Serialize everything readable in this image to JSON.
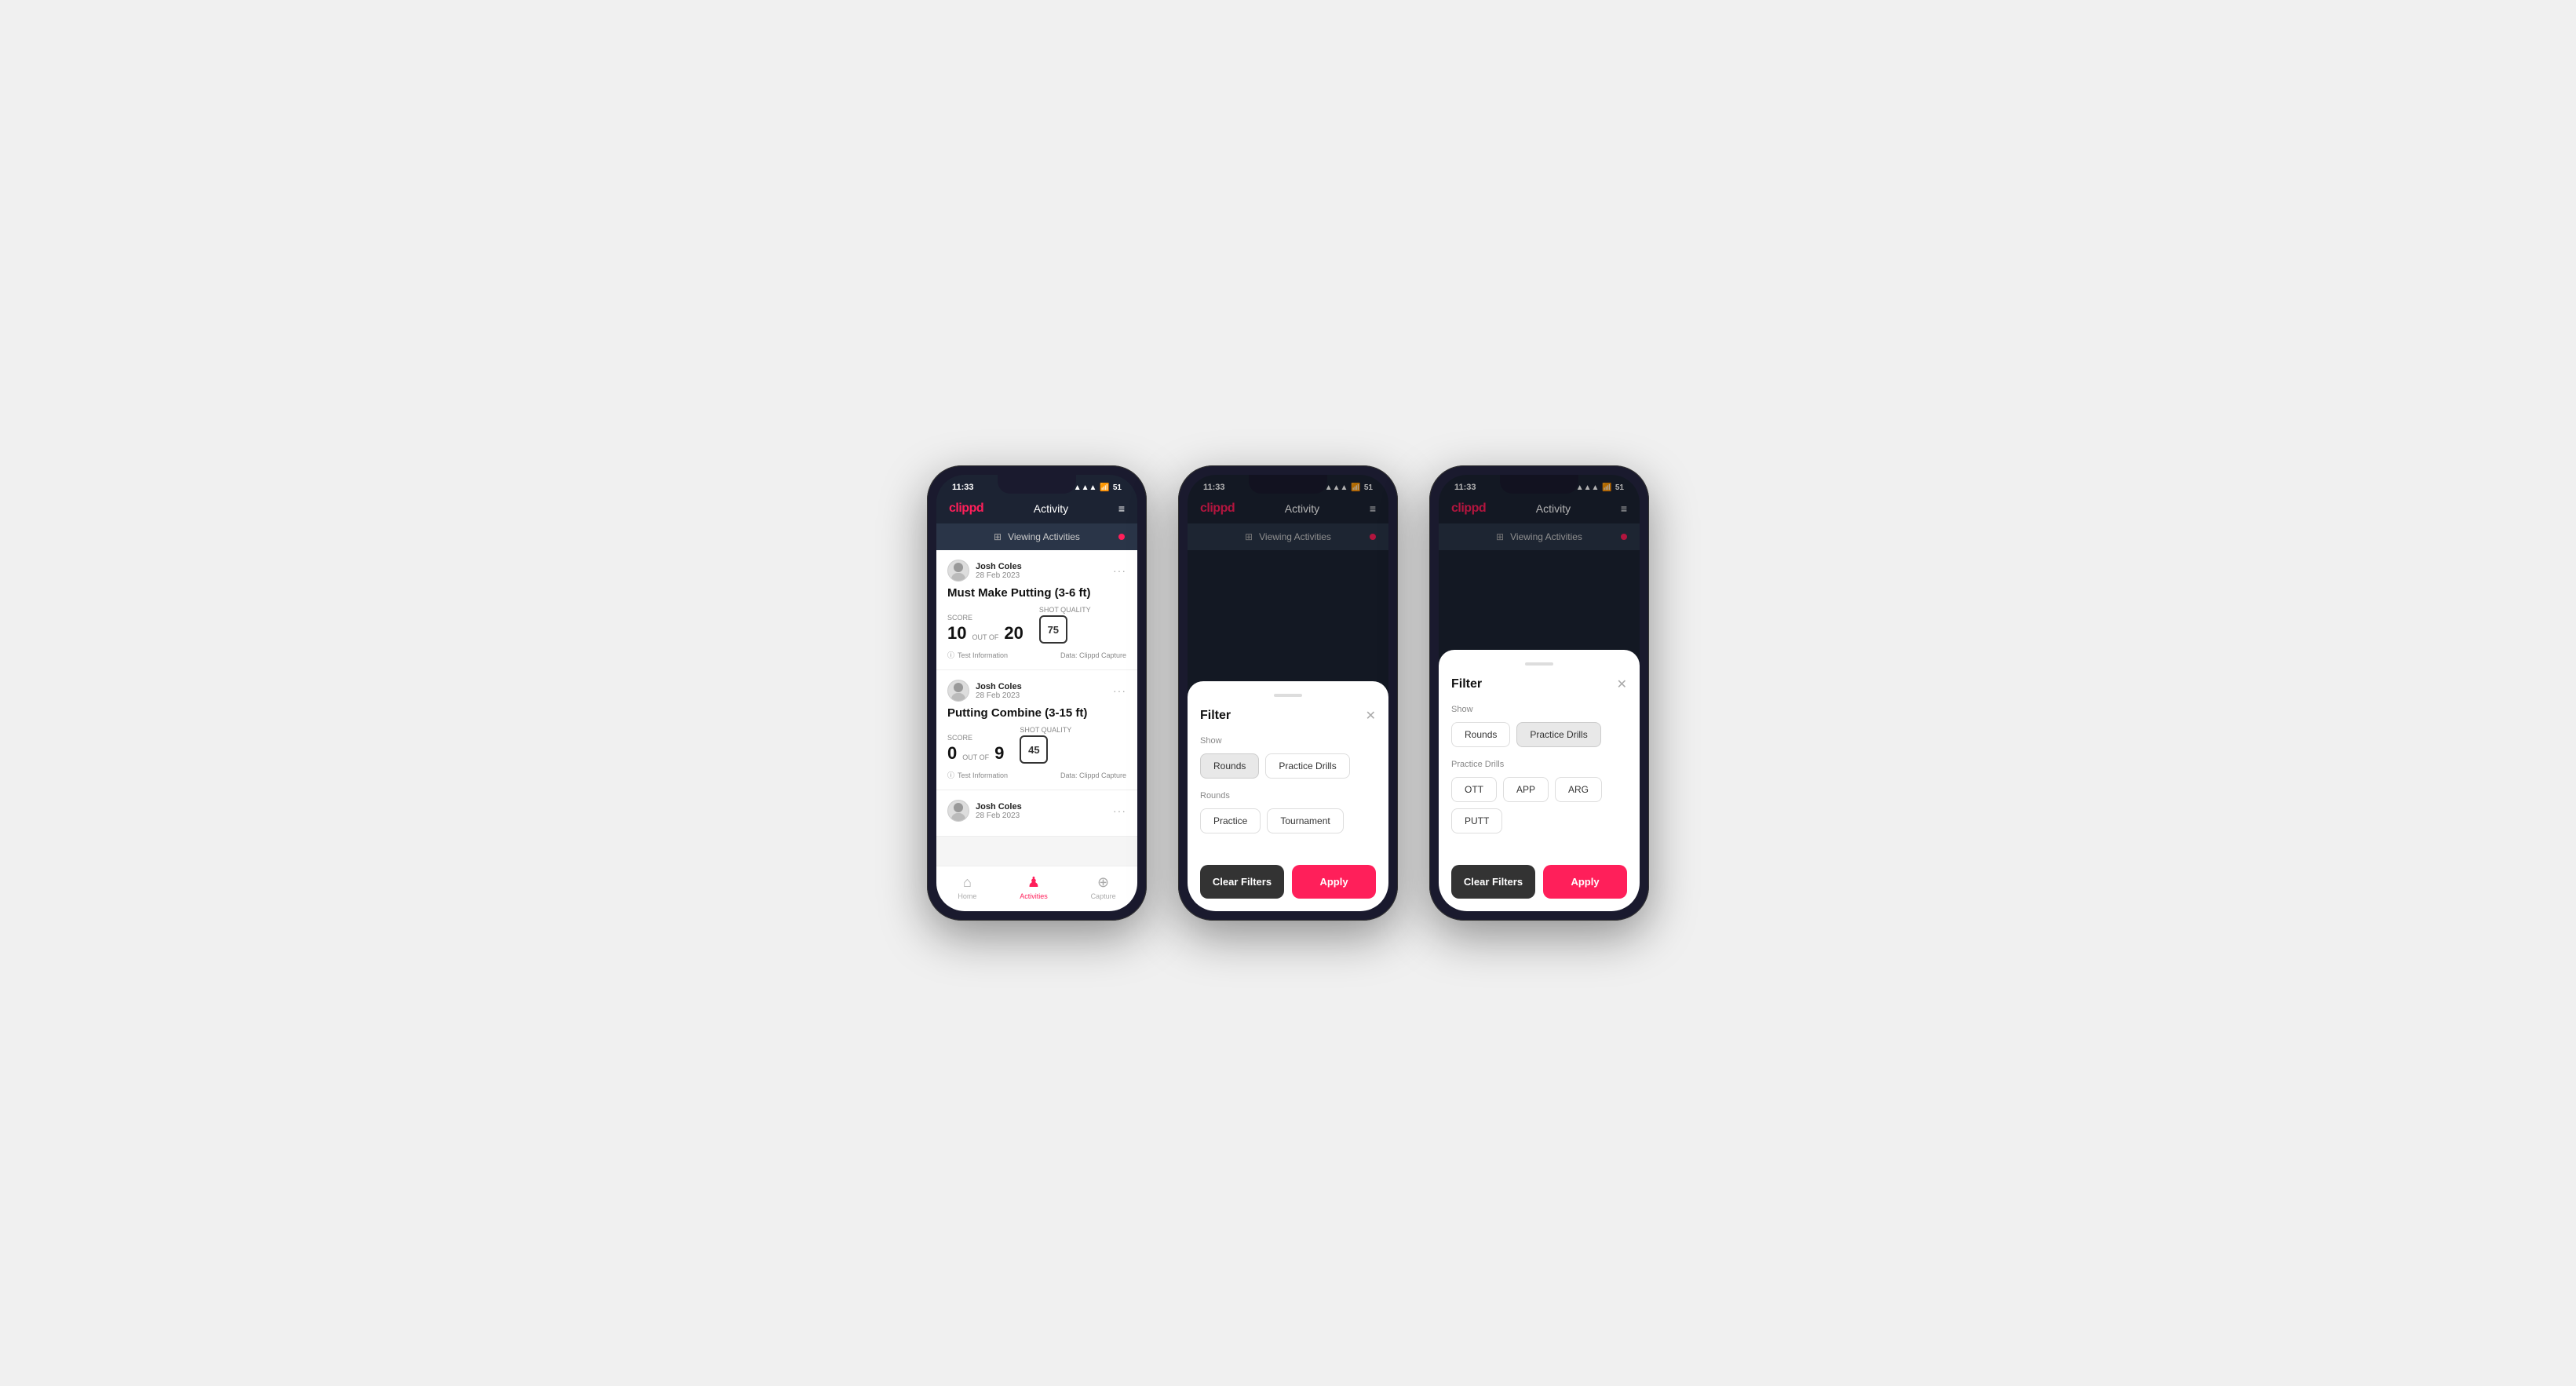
{
  "statusBar": {
    "time": "11:33",
    "signal": "▲▲▲",
    "wifi": "wifi",
    "battery": "51"
  },
  "header": {
    "logo": "clippd",
    "title": "Activity",
    "menuIcon": "≡"
  },
  "viewingBar": {
    "icon": "⊞",
    "text": "Viewing Activities"
  },
  "phone1": {
    "activities": [
      {
        "userName": "Josh Coles",
        "date": "28 Feb 2023",
        "title": "Must Make Putting (3-6 ft)",
        "scoreLine": {
          "label": "Score",
          "value": "10",
          "outof": "OUT OF",
          "shots": "20"
        },
        "shotQuality": {
          "label": "Shot Quality",
          "value": "75"
        },
        "footer": {
          "info": "Test Information",
          "data": "Data: Clippd Capture"
        }
      },
      {
        "userName": "Josh Coles",
        "date": "28 Feb 2023",
        "title": "Putting Combine (3-15 ft)",
        "scoreLine": {
          "label": "Score",
          "value": "0",
          "outof": "OUT OF",
          "shots": "9"
        },
        "shotQuality": {
          "label": "Shot Quality",
          "value": "45"
        },
        "footer": {
          "info": "Test Information",
          "data": "Data: Clippd Capture"
        }
      },
      {
        "userName": "Josh Coles",
        "date": "28 Feb 2023",
        "title": "",
        "partial": true
      }
    ],
    "nav": {
      "home": {
        "label": "Home",
        "active": false
      },
      "activities": {
        "label": "Activities",
        "active": true
      },
      "capture": {
        "label": "Capture",
        "active": false
      }
    }
  },
  "phone2": {
    "filter": {
      "title": "Filter",
      "showLabel": "Show",
      "showOptions": [
        {
          "label": "Rounds",
          "active": true
        },
        {
          "label": "Practice Drills",
          "active": false
        }
      ],
      "roundsLabel": "Rounds",
      "roundOptions": [
        {
          "label": "Practice",
          "active": false
        },
        {
          "label": "Tournament",
          "active": false
        }
      ],
      "clearLabel": "Clear Filters",
      "applyLabel": "Apply"
    }
  },
  "phone3": {
    "filter": {
      "title": "Filter",
      "showLabel": "Show",
      "showOptions": [
        {
          "label": "Rounds",
          "active": false
        },
        {
          "label": "Practice Drills",
          "active": true
        }
      ],
      "drillsLabel": "Practice Drills",
      "drillOptions": [
        {
          "label": "OTT",
          "active": false
        },
        {
          "label": "APP",
          "active": false
        },
        {
          "label": "ARG",
          "active": false
        },
        {
          "label": "PUTT",
          "active": false
        }
      ],
      "clearLabel": "Clear Filters",
      "applyLabel": "Apply"
    }
  }
}
